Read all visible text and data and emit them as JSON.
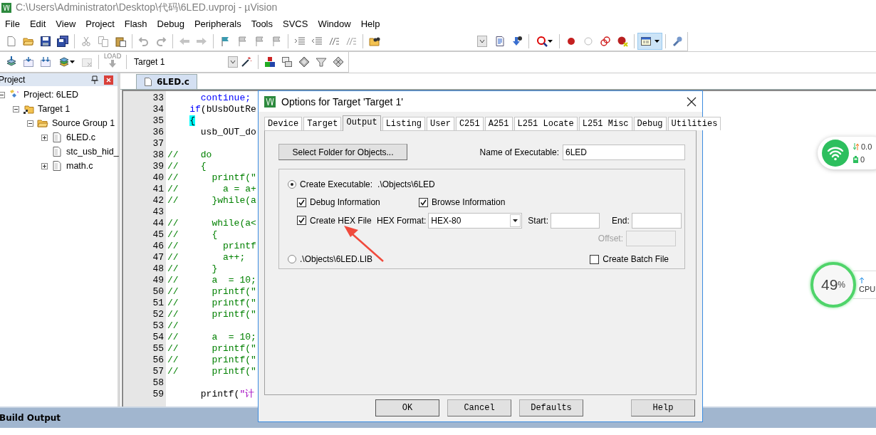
{
  "window": {
    "title": "C:\\Users\\Administrator\\Desktop\\代码\\6LED.uvproj - µVision"
  },
  "menu": [
    "File",
    "Edit",
    "View",
    "Project",
    "Flash",
    "Debug",
    "Peripherals",
    "Tools",
    "SVCS",
    "Window",
    "Help"
  ],
  "toolbar": {
    "window_toggle": {
      "on": true
    }
  },
  "build_toolbar": {
    "load_label": "LOAD",
    "target": "Target 1"
  },
  "project_panel": {
    "title": "Project",
    "tree": [
      {
        "label": "Project: 6LED",
        "kind": "project",
        "expanded": true,
        "children": [
          {
            "label": "Target 1",
            "kind": "target",
            "expanded": true,
            "children": [
              {
                "label": "Source Group 1",
                "kind": "group",
                "expanded": true,
                "children": [
                  {
                    "label": "6LED.c",
                    "kind": "file",
                    "expanded": false
                  },
                  {
                    "label": "stc_usb_hid_",
                    "kind": "file"
                  },
                  {
                    "label": "math.c",
                    "kind": "file",
                    "expanded": false
                  }
                ]
              }
            ]
          }
        ]
      }
    ]
  },
  "editor": {
    "tabs": [
      {
        "label": "6LED.c",
        "selected": true
      }
    ],
    "lines": [
      {
        "number": "33",
        "parts": [
          {
            "text": "      continue;",
            "kind": "keyword"
          }
        ]
      },
      {
        "number": "34",
        "parts": [
          {
            "text": "    if",
            "kind": "keyword"
          },
          {
            "text": "(bUsbOutRe",
            "kind": "plain"
          }
        ]
      },
      {
        "number": "35",
        "parts": [
          {
            "text": "    {",
            "kind": "matched-brace"
          }
        ]
      },
      {
        "number": "36",
        "parts": [
          {
            "text": "      usb_OUT_do",
            "kind": "plain"
          }
        ]
      },
      {
        "number": "37"
      },
      {
        "number": "38",
        "parts": [
          {
            "text": "//    do",
            "kind": "comment"
          }
        ]
      },
      {
        "number": "39",
        "parts": [
          {
            "text": "//    {",
            "kind": "comment"
          }
        ]
      },
      {
        "number": "40",
        "parts": [
          {
            "text": "//      printf(\"",
            "kind": "comment"
          }
        ]
      },
      {
        "number": "41",
        "parts": [
          {
            "text": "//        a = a+",
            "kind": "comment"
          }
        ]
      },
      {
        "number": "42",
        "parts": [
          {
            "text": "//      }while(a",
            "kind": "comment"
          }
        ]
      },
      {
        "number": "43"
      },
      {
        "number": "44",
        "parts": [
          {
            "text": "//      while(a<",
            "kind": "comment"
          }
        ]
      },
      {
        "number": "45",
        "parts": [
          {
            "text": "//      {",
            "kind": "comment"
          }
        ]
      },
      {
        "number": "46",
        "parts": [
          {
            "text": "//        printf",
            "kind": "comment"
          }
        ]
      },
      {
        "number": "47",
        "parts": [
          {
            "text": "//        a++;",
            "kind": "comment"
          }
        ]
      },
      {
        "number": "48",
        "parts": [
          {
            "text": "//      }",
            "kind": "comment"
          }
        ]
      },
      {
        "number": "49",
        "parts": [
          {
            "text": "//      a  = 10;",
            "kind": "comment"
          }
        ]
      },
      {
        "number": "50",
        "parts": [
          {
            "text": "//      printf(\"",
            "kind": "comment"
          }
        ]
      },
      {
        "number": "51",
        "parts": [
          {
            "text": "//      printf(\"",
            "kind": "comment"
          }
        ]
      },
      {
        "number": "52",
        "parts": [
          {
            "text": "//      printf(\"",
            "kind": "comment"
          }
        ]
      },
      {
        "number": "53",
        "parts": [
          {
            "text": "//",
            "kind": "comment"
          }
        ]
      },
      {
        "number": "54",
        "parts": [
          {
            "text": "//      a  = 10;",
            "kind": "comment"
          }
        ]
      },
      {
        "number": "55",
        "parts": [
          {
            "text": "//      printf(\"",
            "kind": "comment"
          }
        ]
      },
      {
        "number": "56",
        "parts": [
          {
            "text": "//      printf(\"",
            "kind": "comment"
          }
        ]
      },
      {
        "number": "57",
        "parts": [
          {
            "text": "//      printf(\"",
            "kind": "comment"
          }
        ]
      },
      {
        "number": "58"
      },
      {
        "number": "59",
        "parts": [
          {
            "text": "      printf(",
            "kind": "plain"
          },
          {
            "text": "\"计",
            "kind": "string"
          }
        ]
      }
    ]
  },
  "output_panel": {
    "title": "Build Output"
  },
  "dialog": {
    "title": "Options for Target 'Target 1'",
    "tabs": [
      {
        "label": "Device",
        "selected": false
      },
      {
        "label": "Target",
        "selected": false
      },
      {
        "label": "Output",
        "selected": true
      },
      {
        "label": "Listing",
        "selected": false
      },
      {
        "label": "User",
        "selected": false
      },
      {
        "label": "C251",
        "selected": false
      },
      {
        "label": "A251",
        "selected": false
      },
      {
        "label": "L251 Locate",
        "selected": false
      },
      {
        "label": "L251 Misc",
        "selected": false
      },
      {
        "label": "Debug",
        "selected": false
      },
      {
        "label": "Utilities",
        "selected": false
      }
    ],
    "folder_button": "Select Folder for Objects...",
    "executable_name": {
      "label": "Name of Executable:",
      "value": "6LED"
    },
    "output_mode": [
      {
        "label": "Create Executable:",
        "path": ".\\Objects\\6LED",
        "selected": true
      },
      {
        "label": ".\\Objects\\6LED.LIB",
        "selected": false
      }
    ],
    "options": [
      {
        "label": "Debug Information",
        "checked": true
      },
      {
        "label": "Browse Information",
        "checked": true
      },
      {
        "label": "Create HEX File",
        "checked": true
      }
    ],
    "hex_format": {
      "label": "HEX Format:",
      "value": "HEX-80"
    },
    "start": {
      "label": "Start:"
    },
    "end": {
      "label": "End:"
    },
    "offset": {
      "label": "Offset:",
      "disabled": true
    },
    "batch_file": {
      "label": "Create Batch File",
      "checked": false
    },
    "buttons": [
      "OK",
      "Cancel",
      "Defaults",
      "Help"
    ]
  },
  "widgets": {
    "network": {
      "speed": "0.0",
      "count": "0"
    },
    "cpu": {
      "value": "49",
      "unit": "%",
      "label": "CPU"
    }
  }
}
